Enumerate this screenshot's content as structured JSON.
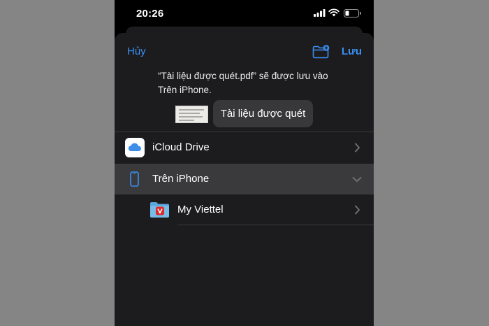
{
  "status_bar": {
    "time": "20:26",
    "signal_icon": "cellular-signal-icon",
    "wifi_icon": "wifi-icon",
    "battery_icon": "battery-icon"
  },
  "nav": {
    "cancel": "Hủy",
    "save": "Lưu",
    "new_folder_icon": "new-folder-icon"
  },
  "message": {
    "line1": "“Tài liệu được quét.pdf” sẽ được lưu vào",
    "line2": "Trên iPhone."
  },
  "file_name": "Tài liệu được quét",
  "locations": [
    {
      "label": "iCloud Drive",
      "icon": "icloud-drive-icon",
      "disclosure": "chevron-right-icon",
      "selected": false
    },
    {
      "label": "Trên iPhone",
      "icon": "iphone-icon",
      "disclosure": "chevron-down-icon",
      "selected": true
    },
    {
      "label": "My Viettel",
      "icon": "folder-icon",
      "disclosure": "chevron-right-icon",
      "selected": false
    }
  ],
  "colors": {
    "accent": "#3b8ff3",
    "sheet": "#1c1c1e",
    "selected_row": "#3a3a3c",
    "backdrop": "#858585"
  }
}
